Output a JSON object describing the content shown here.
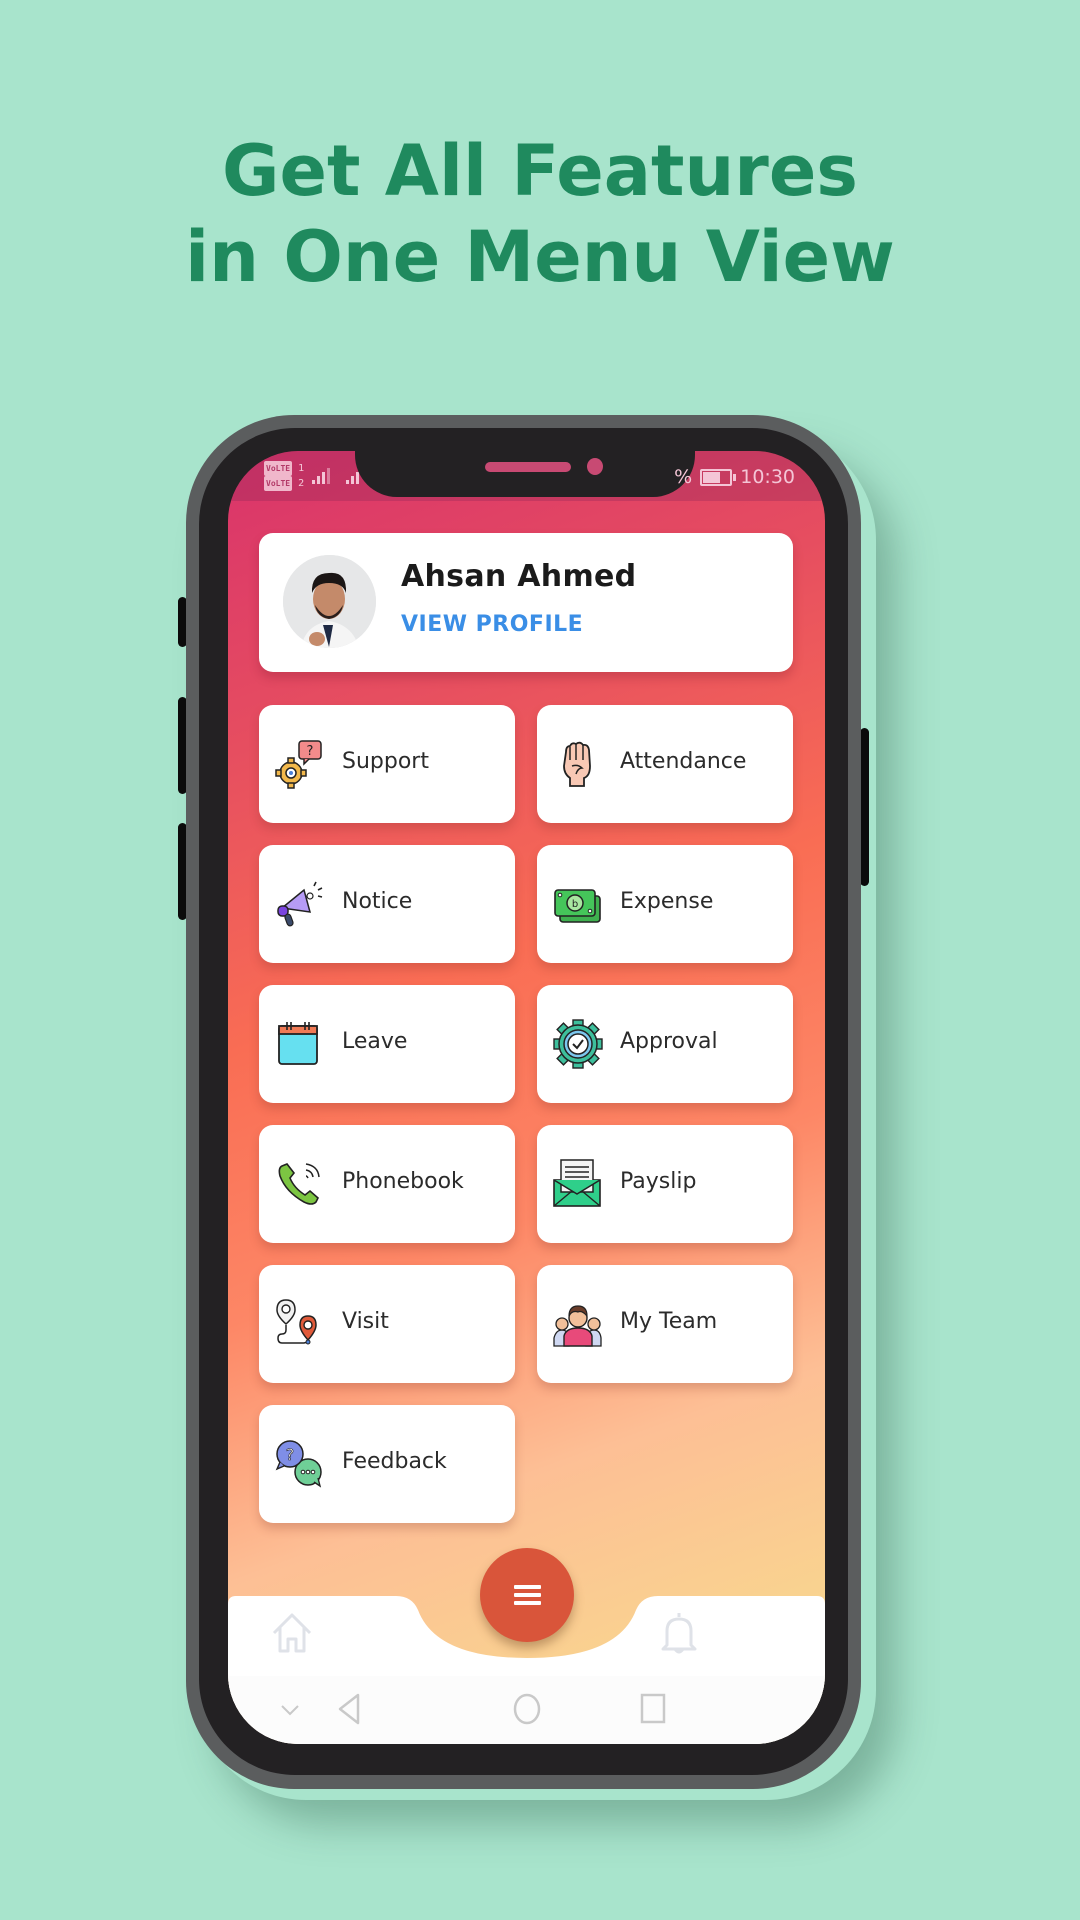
{
  "headline": {
    "line1": "Get All Features",
    "line2": "in One Menu View"
  },
  "colors": {
    "background": "#a8e4cc",
    "headline": "#1f8a5e",
    "link": "#3a8ee6",
    "fab": "#d9553a"
  },
  "statusbar": {
    "sim1": "VoLTE",
    "sim2": "VoLTE",
    "battery_partial": "%",
    "battery_level": 0.6,
    "time": "10:30"
  },
  "profile": {
    "name": "Ahsan Ahmed",
    "link_label": "VIEW PROFILE"
  },
  "menu": {
    "items": [
      {
        "label": "Support",
        "icon": "support-gear-icon"
      },
      {
        "label": "Attendance",
        "icon": "raised-fist-icon"
      },
      {
        "label": "Notice",
        "icon": "megaphone-icon"
      },
      {
        "label": "Expense",
        "icon": "money-bills-icon"
      },
      {
        "label": "Leave",
        "icon": "calendar-icon"
      },
      {
        "label": "Approval",
        "icon": "gear-check-icon"
      },
      {
        "label": "Phonebook",
        "icon": "phone-call-icon"
      },
      {
        "label": "Payslip",
        "icon": "envelope-payslip-icon"
      },
      {
        "label": "Visit",
        "icon": "map-route-icon"
      },
      {
        "label": "My Team",
        "icon": "team-icon"
      },
      {
        "label": "Feedback",
        "icon": "chat-bubbles-icon"
      }
    ]
  },
  "bottom_nav": {
    "left": "home-icon",
    "center": "menu-icon",
    "right": "bell-icon"
  },
  "system_nav": [
    "chevron-down-icon",
    "back-icon",
    "home-circle-icon",
    "recents-icon"
  ]
}
